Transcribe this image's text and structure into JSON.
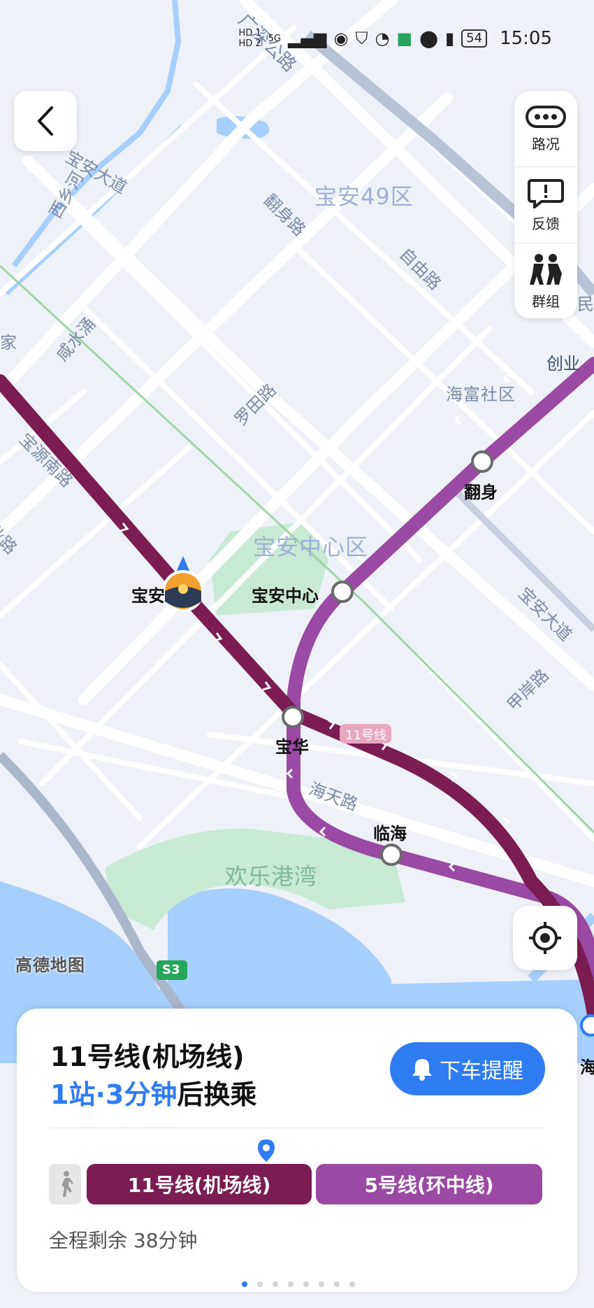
{
  "status": {
    "hd1": "HD 1",
    "hd2": "HD 2",
    "net": "5G",
    "battery": "54",
    "time": "15:05"
  },
  "side_panel": [
    {
      "label": "路况",
      "icon": "traffic-icon"
    },
    {
      "label": "反馈",
      "icon": "feedback-icon"
    },
    {
      "label": "群组",
      "icon": "group-icon"
    }
  ],
  "map": {
    "roads": [
      "广深公路",
      "宝安大道",
      "西乡河",
      "翻身路",
      "自由路",
      "咸水涌",
      "罗田路",
      "宝源南路",
      "创业",
      "海天路",
      "甲岸路",
      "宝安大道",
      "家",
      "业路",
      "民"
    ],
    "districts": [
      "宝安49区",
      "海富社区",
      "宝安中心区",
      "欢乐港湾"
    ],
    "stations": [
      "翻身",
      "宝安中心",
      "宝华",
      "临海",
      "宝安",
      "海"
    ],
    "line_tag": "11号线",
    "highway_tag": "S3",
    "logo": "高德地图"
  },
  "colors": {
    "line11": "#7b1c52",
    "line5": "#9a4aa3",
    "accent": "#2f7bf2",
    "water": "#a6d0fb",
    "park": "#bfe7cf"
  },
  "card": {
    "line_title": "11号线(机场线)",
    "transfer_highlight": "1站·3分钟",
    "transfer_suffix": "后换乘",
    "remind_label": "下车提醒",
    "segment1": "11号线(机场线)",
    "segment2": "5号线(环中线)",
    "remaining": "全程剩余 38分钟"
  }
}
